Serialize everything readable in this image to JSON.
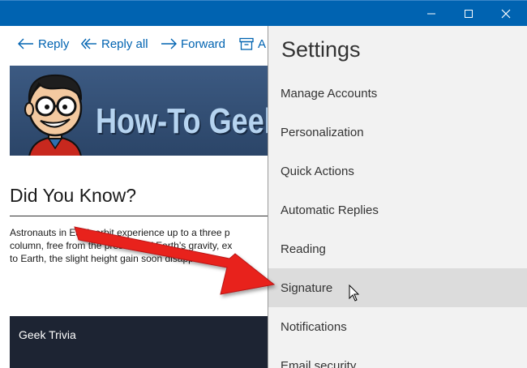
{
  "toolbar": {
    "reply": "Reply",
    "reply_all": "Reply all",
    "forward": "Forward",
    "archive": "A"
  },
  "email": {
    "banner_title": "How-To Geek",
    "heading": "Did You Know?",
    "body_lines": [
      "Astronauts in Earth orbit experience up to a three p",
      "column, free from the pressure of Earth’s gravity, ex",
      "to Earth, the slight height gain soon disappears."
    ],
    "trivia_label": "Geek Trivia"
  },
  "settings": {
    "title": "Settings",
    "items": [
      {
        "label": "Manage Accounts"
      },
      {
        "label": "Personalization"
      },
      {
        "label": "Quick Actions"
      },
      {
        "label": "Automatic Replies"
      },
      {
        "label": "Reading"
      },
      {
        "label": "Signature",
        "hovered": true
      },
      {
        "label": "Notifications"
      },
      {
        "label": "Email security"
      }
    ]
  },
  "colors": {
    "accent": "#0063b1",
    "panel_bg": "#f2f2f2",
    "hover_bg": "#dcdcdc",
    "annotation_arrow": "#e8201f"
  },
  "icons": {
    "reply": "reply-arrow-icon",
    "reply_all": "reply-all-icon",
    "forward": "forward-arrow-icon",
    "archive": "archive-box-icon",
    "minimize": "minimize-icon",
    "maximize": "maximize-icon",
    "close": "close-icon",
    "cursor": "mouse-pointer-icon"
  }
}
